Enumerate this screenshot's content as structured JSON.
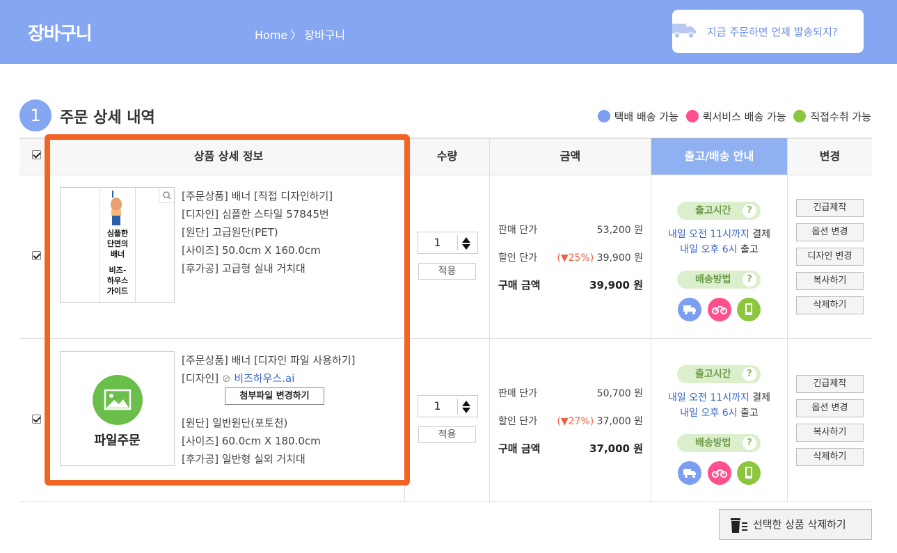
{
  "header": {
    "title": "장바구니",
    "breadcrumb_home": "Home",
    "breadcrumb_sep": "〉",
    "breadcrumb_current": "장바구니",
    "ship_question": "지금 주문하면 언제 발송되지?"
  },
  "section": {
    "step_number": "1",
    "title": "주문 상세 내역"
  },
  "legend": [
    {
      "label": "택배 배송 가능",
      "color": "#7b9ef0"
    },
    {
      "label": "퀵서비스 배송 가능",
      "color": "#ff4f8d"
    },
    {
      "label": "직접수취 가능",
      "color": "#8cc63f"
    }
  ],
  "columns": {
    "product": "상품 상세 정보",
    "qty": "수량",
    "amount": "금액",
    "shipping": "출고/배송 안내",
    "change": "변경"
  },
  "items": [
    {
      "thumb_lines": [
        "심플한",
        "단면의",
        "배너",
        "비즈-",
        "하우스",
        "가이드"
      ],
      "info": [
        "[주문상품] 배너 [직접 디자인하기]",
        "[디자인] 심플한 스타일 57845번",
        "[원단] 고급원단(PET)",
        "[사이즈] 50.0cm X 160.0cm",
        "[후가공] 고급형 실내 거치대"
      ],
      "qty": "1",
      "apply": "적용",
      "sale_label": "판매 단가",
      "sale_value": "53,200 원",
      "disc_label": "할인 단가",
      "disc_rate": "(▼25%)",
      "disc_value": "39,900 원",
      "total_label": "구매 금액",
      "total_value": "39,900 원",
      "ship_time_label": "출고시간",
      "ship_line1_blue": "내일 오전 11시까지",
      "ship_line1_rest": " 결제",
      "ship_line2_blue": "내일 오후 6시",
      "ship_line2_rest": " 출고",
      "ship_method_label": "배송방법",
      "buttons": [
        "긴급제작",
        "옵션 변경",
        "디자인 변경",
        "복사하기",
        "삭제하기"
      ]
    },
    {
      "thumb_label": "파일주문",
      "info_1": "[주문상품] 배너 [디자인 파일 사용하기]",
      "info_2_label": "[디자인] ",
      "info_2_file": "비즈하우스.ai",
      "attach_btn": "첨부파일 변경하기",
      "info_3": "[원단] 일반원단(포토천)",
      "info_4": "[사이즈] 60.0cm X 180.0cm",
      "info_5": "[후가공] 일반형 실외 거치대",
      "qty": "1",
      "apply": "적용",
      "sale_label": "판매 단가",
      "sale_value": "50,700 원",
      "disc_label": "할인 단가",
      "disc_rate": "(▼27%)",
      "disc_value": "37,000 원",
      "total_label": "구매 금액",
      "total_value": "37,000 원",
      "ship_time_label": "출고시간",
      "ship_line1_blue": "내일 오전 11시까지",
      "ship_line1_rest": " 결제",
      "ship_line2_blue": "내일 오후 6시",
      "ship_line2_rest": " 출고",
      "ship_method_label": "배송방법",
      "buttons": [
        "긴급제작",
        "옵션 변경",
        "복사하기",
        "삭제하기"
      ]
    }
  ],
  "delete_selected": "선택한 상품 삭제하기",
  "colors": {
    "header_bg": "#85a6f0",
    "highlight": "#f26424",
    "discount": "#f06040",
    "link": "#3a64c8"
  }
}
